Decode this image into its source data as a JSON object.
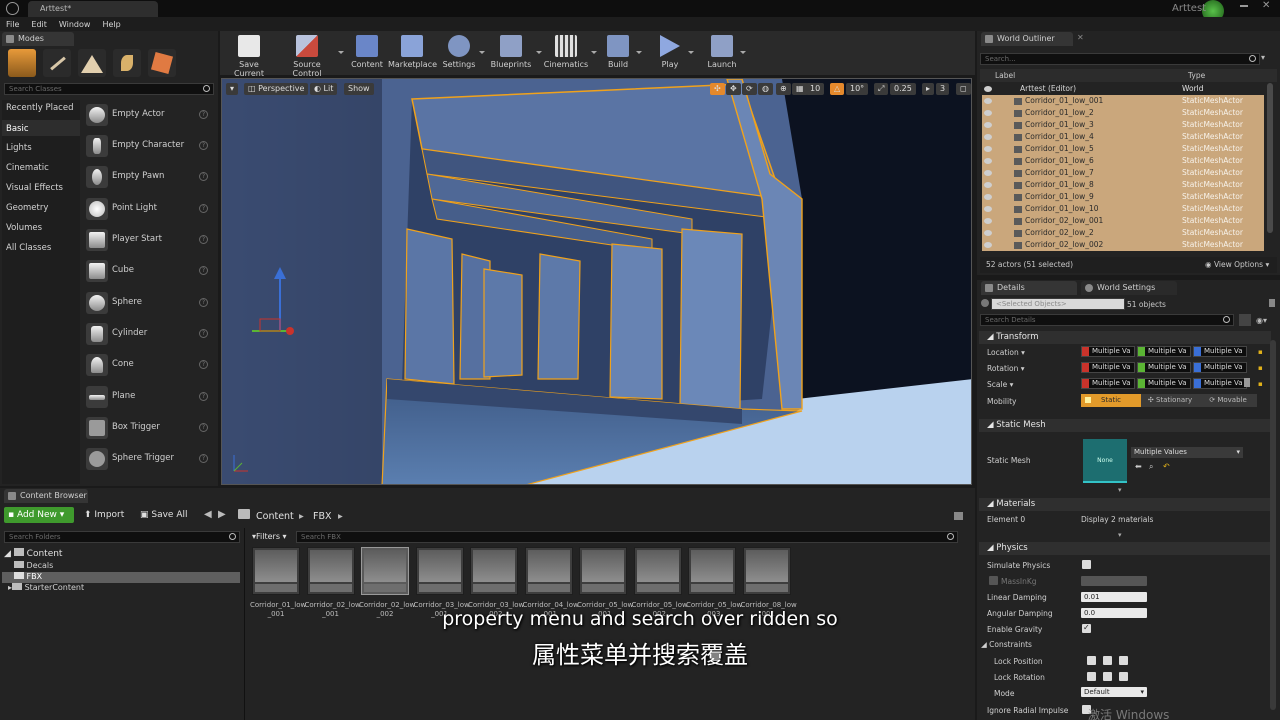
{
  "window": {
    "tab_title": "Arttest*",
    "user_name": "Arttest"
  },
  "menu": [
    "File",
    "Edit",
    "Window",
    "Help"
  ],
  "toolbar": {
    "buttons": [
      {
        "label": "Save Current",
        "color": "#e8e8e8"
      },
      {
        "label": "Source Control",
        "color": "#c94a3d"
      },
      {
        "label": "Content",
        "color": "#6a86c8"
      },
      {
        "label": "Marketplace",
        "color": "#8aa3d8"
      },
      {
        "label": "Settings",
        "color": "#7f95c2"
      },
      {
        "label": "Blueprints",
        "color": "#8fa0c6"
      },
      {
        "label": "Cinematics",
        "color": "#cfcfcf"
      },
      {
        "label": "Build",
        "color": "#7f95c2"
      },
      {
        "label": "Play",
        "color": "#8fa8e0"
      },
      {
        "label": "Launch",
        "color": "#8fa0c6"
      }
    ]
  },
  "modes": {
    "tab_label": "Modes",
    "search_placeholder": "Search Classes",
    "categories": [
      "Recently Placed",
      "Basic",
      "Lights",
      "Cinematic",
      "Visual Effects",
      "Geometry",
      "Volumes",
      "All Classes"
    ],
    "selected_category": "Basic",
    "items": [
      "Empty Actor",
      "Empty Character",
      "Empty Pawn",
      "Point Light",
      "Player Start",
      "Cube",
      "Sphere",
      "Cylinder",
      "Cone",
      "Plane",
      "Box Trigger",
      "Sphere Trigger"
    ]
  },
  "viewport": {
    "perspective_label": "Perspective",
    "lit_label": "Lit",
    "show_label": "Show",
    "grid_snap": "10",
    "rotation_snap": "10°",
    "scale_snap": "0.25",
    "camera_speed": "3"
  },
  "outliner": {
    "tab_label": "World Outliner",
    "search_placeholder": "Search...",
    "col_label": "Label",
    "col_type": "Type",
    "root": {
      "label": "Arttest (Editor)",
      "type": "World"
    },
    "rows": [
      {
        "label": "Corridor_01_low_001",
        "type": "StaticMeshActor"
      },
      {
        "label": "Corridor_01_low_2",
        "type": "StaticMeshActor"
      },
      {
        "label": "Corridor_01_low_3",
        "type": "StaticMeshActor"
      },
      {
        "label": "Corridor_01_low_4",
        "type": "StaticMeshActor"
      },
      {
        "label": "Corridor_01_low_5",
        "type": "StaticMeshActor"
      },
      {
        "label": "Corridor_01_low_6",
        "type": "StaticMeshActor"
      },
      {
        "label": "Corridor_01_low_7",
        "type": "StaticMeshActor"
      },
      {
        "label": "Corridor_01_low_8",
        "type": "StaticMeshActor"
      },
      {
        "label": "Corridor_01_low_9",
        "type": "StaticMeshActor"
      },
      {
        "label": "Corridor_01_low_10",
        "type": "StaticMeshActor"
      },
      {
        "label": "Corridor_02_low_001",
        "type": "StaticMeshActor"
      },
      {
        "label": "Corridor_02_low_2",
        "type": "StaticMeshActor"
      },
      {
        "label": "Corridor_02_low_002",
        "type": "StaticMeshActor"
      }
    ],
    "status": "52 actors (51 selected)",
    "view_options": "View Options"
  },
  "details": {
    "tab_label": "Details",
    "world_settings_tab": "World Settings",
    "selected_objects_placeholder": "<Selected Objects>",
    "objects_count": "51 objects",
    "search_placeholder": "Search Details",
    "transform_header": "Transform",
    "location_label": "Location",
    "rotation_label": "Rotation",
    "scale_label": "Scale",
    "multiple_value": "Multiple Va",
    "mobility_label": "Mobility",
    "mobility_static": "Static",
    "mobility_stationary": "Stationary",
    "mobility_movable": "Movable",
    "static_mesh_header": "Static Mesh",
    "static_mesh_label": "Static Mesh",
    "static_mesh_thumb": "None",
    "static_mesh_value": "Multiple Values",
    "materials_header": "Materials",
    "element_label": "Element 0",
    "element_value": "Display 2 materials",
    "physics_header": "Physics",
    "simulate_physics": "Simulate Physics",
    "mass_kg": "MassInKg",
    "linear_damping": "Linear Damping",
    "linear_damping_value": "0.01",
    "angular_damping": "Angular Damping",
    "angular_damping_value": "0.0",
    "enable_gravity": "Enable Gravity",
    "constraints": "Constraints",
    "lock_position": "Lock Position",
    "lock_rotation": "Lock Rotation",
    "mode_label": "Mode",
    "mode_value": "Default",
    "ignore_radial": "Ignore Radial Impulse"
  },
  "content_browser": {
    "tab_label": "Content Browser",
    "add_new": "Add New",
    "import": "Import",
    "save_all": "Save All",
    "path": [
      "Content",
      "FBX"
    ],
    "folder_search_placeholder": "Search Folders",
    "filters": "Filters",
    "asset_search_placeholder": "Search FBX",
    "tree": [
      "Content",
      "Decals",
      "FBX",
      "StarterContent"
    ],
    "assets": [
      {
        "l1": "Corridor_01_low",
        "l2": "_001"
      },
      {
        "l1": "Corridor_02_low",
        "l2": "_001"
      },
      {
        "l1": "Corridor_02_low",
        "l2": "_002"
      },
      {
        "l1": "Corridor_03_low",
        "l2": "_001"
      },
      {
        "l1": "Corridor_03_low",
        "l2": "_002"
      },
      {
        "l1": "Corridor_04_low",
        "l2": "_001"
      },
      {
        "l1": "Corridor_05_low",
        "l2": "_001"
      },
      {
        "l1": "Corridor_05_low",
        "l2": "_002"
      },
      {
        "l1": "Corridor_05_low",
        "l2": "_003"
      },
      {
        "l1": "Corridor_08_low",
        "l2": "_001"
      }
    ]
  },
  "subtitles": {
    "english": "property menu and search over ridden so",
    "chinese": "属性菜单并搜索覆盖"
  },
  "watermark": "激活 Windows",
  "colors": {
    "selection": "#caa77c",
    "accent_green": "#3f9a2d",
    "wire_orange": "#f0a21c",
    "axis_x": "#c9332b",
    "axis_y": "#5bb534",
    "axis_z": "#3a6fd6"
  }
}
